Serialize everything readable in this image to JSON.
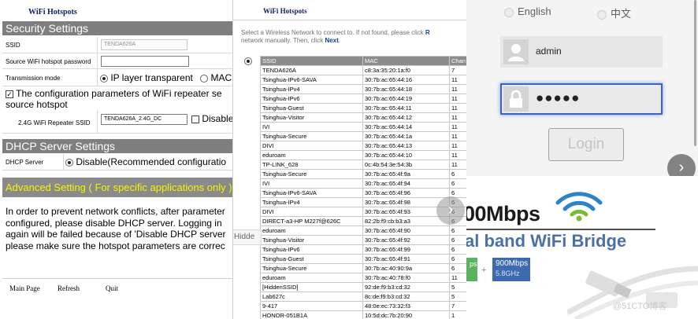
{
  "panel1": {
    "brand": "WiFi Hotspots",
    "security_header": "Security Settings",
    "ssid_label": "SSID",
    "ssid_value": "TENDA626A",
    "password_label": "Source WiFi hotspot password",
    "password_value": "",
    "transmission_label": "Transmission mode",
    "mode_ip_transparent": "IP layer transparent",
    "mode_mac": "MAC",
    "config_text_line1": "The configuration parameters of WiFi repeater se",
    "config_text_line2": "source hotspot",
    "repeater_ssid_label": "2.4G WiFi Repeater SSID",
    "repeater_ssid_value": "TENDA626A_2.4G_DC",
    "disable_label": "Disable",
    "dhcp_header": "DHCP Server Settings",
    "dhcp_server_label": "DHCP Server",
    "dhcp_option": "Disable(Recommended configuratio",
    "advanced": "Advanced Setting ( For specific applications only )",
    "note_lines": [
      "In order to prevent network conflicts, after parameter",
      "configured, please disable DHCP server. Logging in",
      "again will be failed because of 'Disable DHCP server",
      "please make sure the hotspot parameters are correc"
    ],
    "footer": {
      "main_page": "Main Page",
      "refresh": "Refresh",
      "quit": "Quit"
    }
  },
  "panel2": {
    "brand": "WiFi Hotspots",
    "instructions_line1_a": "Select a Wireless Network to connect to. If not found, please click",
    "instructions_line1_b": "R",
    "instructions_line2_a": "network manually. Then, click",
    "instructions_line2_b": "Next",
    "instructions_line2_c": ".",
    "columns": [
      "SSID",
      "MAC",
      "Chan"
    ],
    "networks": [
      {
        "ssid": "TENDA626A",
        "mac": "c8:3a:35:20:1a:f0",
        "ch": "7"
      },
      {
        "ssid": "Tsinghua-IPv6-SAVA",
        "mac": "30:7b:ac:65:44:16",
        "ch": "11"
      },
      {
        "ssid": "Tsinghua-IPv4",
        "mac": "30:7b:ac:65:44:18",
        "ch": "11"
      },
      {
        "ssid": "Tsinghua-IPv6",
        "mac": "30:7b:ac:65:44:19",
        "ch": "11"
      },
      {
        "ssid": "Tsinghua-Guest",
        "mac": "30:7b:ac:65:44:11",
        "ch": "11"
      },
      {
        "ssid": "Tsinghua-Visitor",
        "mac": "30:7b:ac:65:44:12",
        "ch": "11"
      },
      {
        "ssid": "IVI",
        "mac": "30:7b:ac:65:44:14",
        "ch": "11"
      },
      {
        "ssid": "Tsinghua-Secure",
        "mac": "30:7b:ac:65:44:1a",
        "ch": "11"
      },
      {
        "ssid": "DIVI",
        "mac": "30:7b:ac:65:44:13",
        "ch": "11"
      },
      {
        "ssid": "eduroam",
        "mac": "30:7b:ac:65:44:10",
        "ch": "11"
      },
      {
        "ssid": "TP-LINK_628",
        "mac": "0c:4b:54:3e:54:3b",
        "ch": "11"
      },
      {
        "ssid": "Tsinghua-Secure",
        "mac": "30:7b:ac:65:4f:9a",
        "ch": "6"
      },
      {
        "ssid": "IVI",
        "mac": "30:7b:ac:65:4f:94",
        "ch": "6"
      },
      {
        "ssid": "Tsinghua-IPv6-SAVA",
        "mac": "30:7b:ac:65:4f:96",
        "ch": "6"
      },
      {
        "ssid": "Tsinghua-IPv4",
        "mac": "30:7b:ac:65:4f:98",
        "ch": "6"
      },
      {
        "ssid": "DIVI",
        "mac": "30:7b:ac:65:4f:93",
        "ch": "6"
      },
      {
        "ssid": "DIRECT-a3-HP M227f@626C",
        "mac": "82:2b:f9:cb:b3:a3",
        "ch": "6"
      },
      {
        "ssid": "eduroam",
        "mac": "30:7b:ac:65:4f:90",
        "ch": "6"
      },
      {
        "ssid": "Tsinghua-Visitor",
        "mac": "30:7b:ac:65:4f:92",
        "ch": "6"
      },
      {
        "ssid": "Tsinghua-IPv6",
        "mac": "30:7b:ac:65:4f:99",
        "ch": "6"
      },
      {
        "ssid": "Tsinghua-Guest",
        "mac": "30:7b:ac:65:4f:91",
        "ch": "6"
      },
      {
        "ssid": "Tsinghua-Secure",
        "mac": "30:7b:ac:40:90:9a",
        "ch": "6"
      },
      {
        "ssid": "eduroam",
        "mac": "30:7b:ac:40:78:f0",
        "ch": "11"
      },
      {
        "ssid": "[HiddenSSID]",
        "mac": "92:de:f9:b3:cd:32",
        "ch": "5"
      },
      {
        "ssid": "Lab627c",
        "mac": "8c:de:f9:b3:cd:32",
        "ch": "5"
      },
      {
        "ssid": "9-417",
        "mac": "48:0e:ec:73:32:f3",
        "ch": "7"
      },
      {
        "ssid": "HONOR-051B1A",
        "mac": "10:5d:dc:7b:20:90",
        "ch": "1"
      }
    ],
    "hidden_tab_text": "Hidde"
  },
  "panel3": {
    "lang_english": "English",
    "lang_chinese": "中文",
    "username_value": "admin",
    "password_masked": "●●●●●",
    "login_label": "Login",
    "speed_text": "00Mbps",
    "dual_text": "al band WiFi Bridge",
    "pill1": "ps",
    "plus": "+",
    "pill2_line1": "900Mbps",
    "pill2_line2": "5.8GHz",
    "watermark": "@51CTO博客"
  },
  "colors": {
    "brand_navy": "#0a1f66",
    "header_gray": "#7f7f7f",
    "advanced_yellow": "#f4f400",
    "focus_blue": "#3b63c6",
    "wifi_blue": "#2b83c9",
    "wifi_green": "#7cbb34"
  },
  "icons": [
    "user-icon",
    "lock-icon",
    "chevron-right-icon",
    "wifi-logo-icon",
    "radio-icon",
    "checkbox-icon"
  ]
}
